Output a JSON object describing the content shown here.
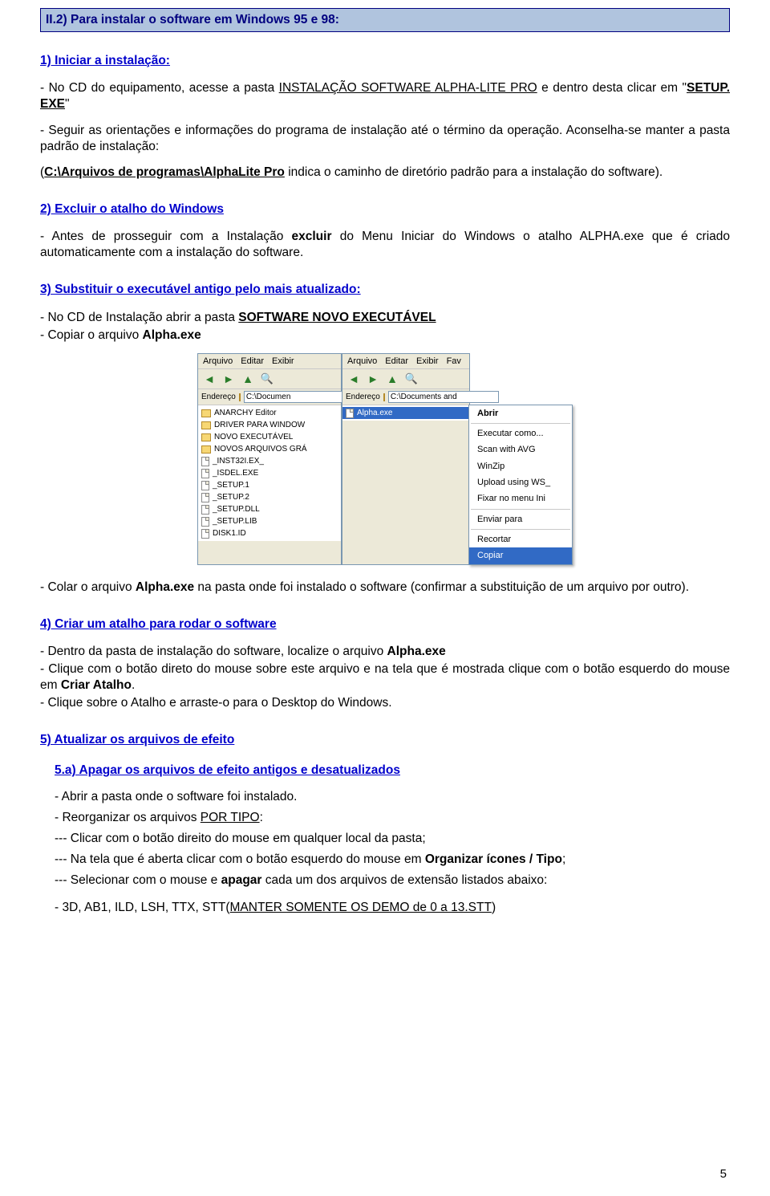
{
  "section_header": "II.2) Para instalar o software em Windows 95 e 98:",
  "step1": {
    "title": "1) Iniciar a instalação:",
    "line1a": "- No CD do equipamento, acesse a pasta ",
    "line1b": "INSTALAÇÃO SOFTWARE ALPHA-LITE PRO",
    "line1c": " e dentro desta clicar em \"",
    "line1d": "SETUP. EXE",
    "line1e": "\"",
    "line2": "- Seguir as orientações e informações do programa de instalação até o término da operação. Aconselha-se manter a pasta padrão de instalação:",
    "line3a": "(",
    "line3b": "C:\\Arquivos de programas\\AlphaLite Pro",
    "line3c": " indica o caminho de diretório padrão para a instalação do software)."
  },
  "step2": {
    "title": "2) Excluir o atalho do Windows",
    "line1": "- Antes de prosseguir com a Instalação ",
    "line1b": "excluir",
    "line1c": " do Menu Iniciar do Windows o atalho ALPHA.exe  que é criado automaticamente com a instalação do software."
  },
  "step3": {
    "title": "3) Substituir o executável antigo pelo mais atualizado:",
    "line1a": "- No CD de Instalação abrir a pasta ",
    "line1b": "SOFTWARE NOVO EXECUTÁVEL",
    "line2a": "- Copiar o arquivo ",
    "line2b": "Alpha.exe",
    "line3a": "- Colar o arquivo ",
    "line3b": "Alpha.exe",
    "line3c": " na pasta onde foi instalado o software (confirmar a substituição de um arquivo por outro)."
  },
  "step4": {
    "title": "4) Criar um atalho para rodar o software",
    "line1a": "- Dentro da pasta de instalação do software, localize o arquivo ",
    "line1b": "Alpha.exe",
    "line2a": "- Clique com o botão direto do mouse sobre este arquivo e na tela que é mostrada clique com o botão esquerdo do mouse em ",
    "line2b": "Criar Atalho",
    "line2c": ".",
    "line3": "- Clique sobre o Atalho e arraste-o para o Desktop do Windows."
  },
  "step5": {
    "title": "5) Atualizar os arquivos de efeito",
    "sub_a_title": "5.a) Apagar os arquivos de efeito antigos e desatualizados",
    "a1": "- Abrir a pasta onde o software foi instalado.",
    "a2a": "- Reorganizar os arquivos ",
    "a2b": "POR TIPO",
    "a2c": ":",
    "a3": "--- Clicar com o botão direito do mouse em qualquer local da pasta;",
    "a4a": "--- Na tela que é aberta clicar com o botão esquerdo do mouse em ",
    "a4b": "Organizar ícones / Tipo",
    "a4c": ";",
    "a5a": "--- Selecionar com o mouse e ",
    "a5b": "apagar",
    "a5c": " cada um dos arquivos de extensão listados abaixo:",
    "a6a": "- 3D,   AB1,  ILD,  LSH,  TTX, STT(",
    "a6b": "MANTER SOMENTE OS DEMO de 0 a 13.STT",
    "a6c": ")"
  },
  "explorer_left": {
    "menu": [
      "Arquivo",
      "Editar",
      "Exibir"
    ],
    "addr_label": "Endereço",
    "addr_value": "C:\\Documen",
    "files": [
      "ANARCHY Editor",
      "DRIVER PARA WINDOW",
      "NOVO EXECUTÁVEL",
      "NOVOS ARQUIVOS GRÁ",
      "_INST32I.EX_",
      "_ISDEL.EXE",
      "_SETUP.1",
      "_SETUP.2",
      "_SETUP.DLL",
      "_SETUP.LIB",
      "DISK1.ID"
    ],
    "file_types": [
      "folder",
      "folder",
      "folder",
      "folder",
      "file",
      "file",
      "file",
      "file",
      "file",
      "file",
      "file"
    ]
  },
  "explorer_right": {
    "menu": [
      "Arquivo",
      "Editar",
      "Exibir",
      "Fav"
    ],
    "addr_label": "Endereço",
    "addr_value": "C:\\Documents and",
    "file": "Alpha.exe"
  },
  "context_menu": {
    "items": [
      "Abrir",
      "Executar como...",
      "Scan with AVG",
      "WinZip",
      "Upload using WS_",
      "Fixar no menu Ini",
      "Enviar para",
      "Recortar",
      "Copiar"
    ],
    "bold_idx": 0,
    "selected_idx": 8,
    "separators_after": [
      0,
      5,
      6
    ]
  },
  "page_number": "5"
}
